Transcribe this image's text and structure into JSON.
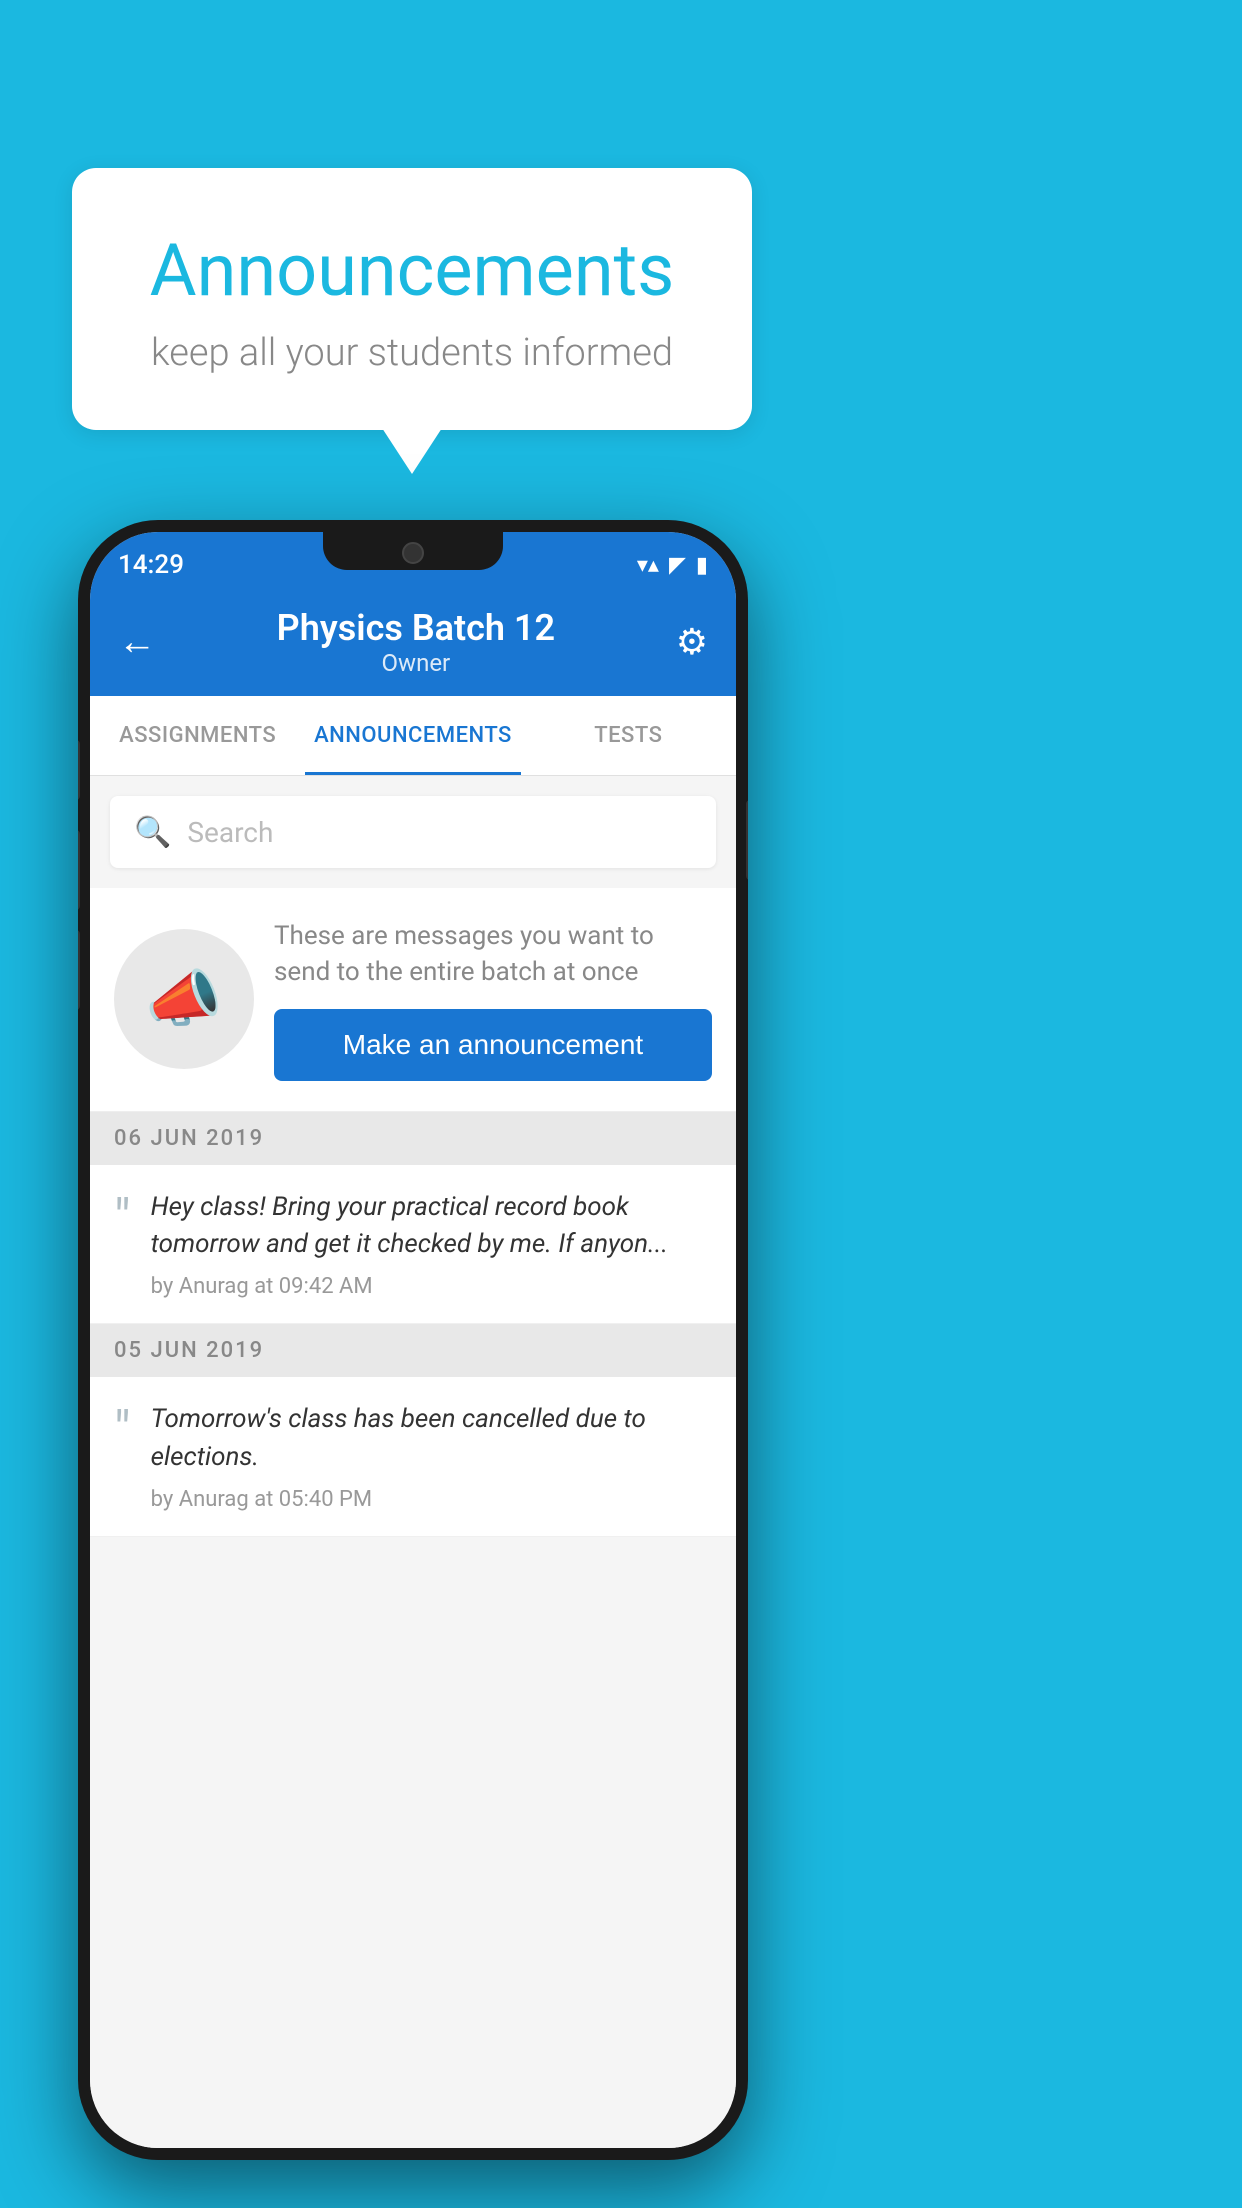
{
  "background_color": "#1BB8E0",
  "bubble": {
    "title": "Announcements",
    "subtitle": "keep all your students informed"
  },
  "phone": {
    "status_bar": {
      "time": "14:29",
      "wifi": "▼",
      "signal": "▲",
      "battery": "▮"
    },
    "header": {
      "title": "Physics Batch 12",
      "subtitle": "Owner",
      "back_label": "←",
      "gear_label": "⚙"
    },
    "tabs": [
      {
        "label": "ASSIGNMENTS",
        "active": false
      },
      {
        "label": "ANNOUNCEMENTS",
        "active": true
      },
      {
        "label": "TESTS",
        "active": false
      },
      {
        "label": "···",
        "active": false
      }
    ],
    "search": {
      "placeholder": "Search"
    },
    "promo": {
      "description": "These are messages you want to send to the entire batch at once",
      "button_label": "Make an announcement"
    },
    "announcements": [
      {
        "date": "06  JUN  2019",
        "text": "Hey class! Bring your practical record book tomorrow and get it checked by me. If anyon...",
        "meta": "by Anurag at 09:42 AM"
      },
      {
        "date": "05  JUN  2019",
        "text": "Tomorrow's class has been cancelled due to elections.",
        "meta": "by Anurag at 05:40 PM"
      }
    ]
  }
}
